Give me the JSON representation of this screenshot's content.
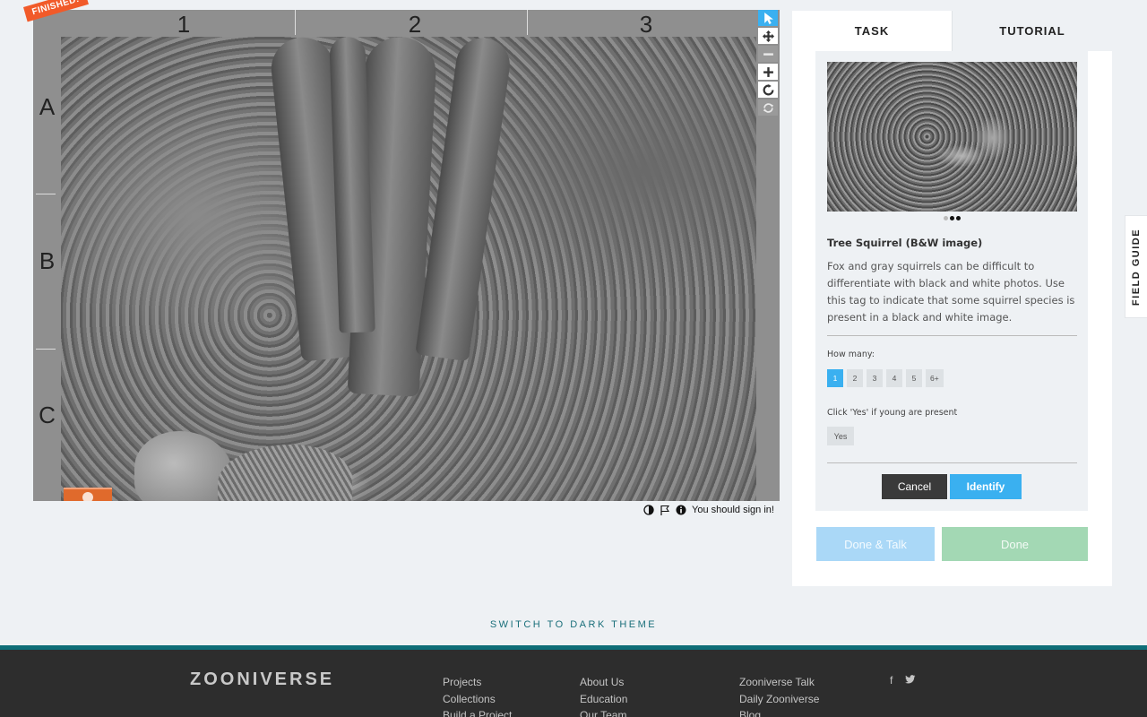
{
  "viewer": {
    "finished_badge": "FINISHED!",
    "columns": [
      "1",
      "2",
      "3"
    ],
    "rows": [
      "A",
      "B",
      "C"
    ],
    "sign_in_notice": "You should sign in!",
    "tools": [
      "pointer-icon",
      "move-icon",
      "zoom-out-icon",
      "zoom-in-icon",
      "rotate-icon",
      "reset-icon"
    ]
  },
  "panel": {
    "tabs": {
      "task": "TASK",
      "tutorial": "TUTORIAL"
    },
    "choice": {
      "title": "Tree Squirrel (B&W image)",
      "description": "Fox and gray squirrels can be difficult to differentiate with black and white photos. Use this tag to indicate that some squirrel species is present in a black and white image.",
      "how_many_label": "How many:",
      "counts": [
        "1",
        "2",
        "3",
        "4",
        "5",
        "6+"
      ],
      "selected_count": "1",
      "young_label": "Click 'Yes' if young are present",
      "yes_label": "Yes",
      "cancel_label": "Cancel",
      "identify_label": "Identify"
    },
    "done_talk_label": "Done & Talk",
    "done_label": "Done"
  },
  "field_guide_label": "FIELD GUIDE",
  "theme_switch_label": "SWITCH TO DARK THEME",
  "footer": {
    "logo": "ZOONIVERSE",
    "col1": [
      "Projects",
      "Collections",
      "Build a Project"
    ],
    "col2": [
      "About Us",
      "Education",
      "Our Team"
    ],
    "col3": [
      "Zooniverse Talk",
      "Daily Zooniverse",
      "Blog"
    ],
    "social": {
      "facebook": "f",
      "twitter": "t"
    }
  },
  "colors": {
    "accent": "#3ab0f0",
    "badge": "#f15a29",
    "footer_bg": "#2d2d2d",
    "footer_accent": "#0e6d77"
  }
}
